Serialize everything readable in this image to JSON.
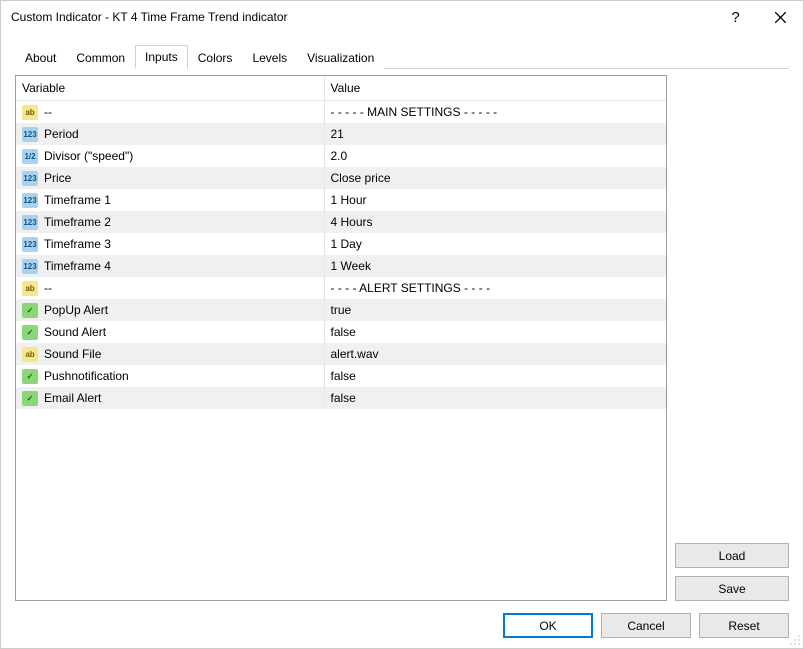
{
  "window": {
    "title": "Custom Indicator - KT 4 Time Frame Trend indicator"
  },
  "tabs": [
    "About",
    "Common",
    "Inputs",
    "Colors",
    "Levels",
    "Visualization"
  ],
  "active_tab": "Inputs",
  "table": {
    "headers": {
      "variable": "Variable",
      "value": "Value"
    },
    "rows": [
      {
        "icon": "string",
        "iconText": "ab",
        "variable": "--",
        "value": "- - - - - MAIN SETTINGS - - - - -"
      },
      {
        "icon": "int",
        "iconText": "123",
        "variable": "Period",
        "value": "21"
      },
      {
        "icon": "double",
        "iconText": "1/2",
        "variable": "Divisor (\"speed\")",
        "value": "2.0"
      },
      {
        "icon": "int",
        "iconText": "123",
        "variable": "Price",
        "value": "Close price"
      },
      {
        "icon": "int",
        "iconText": "123",
        "variable": "Timeframe 1",
        "value": "1 Hour"
      },
      {
        "icon": "int",
        "iconText": "123",
        "variable": "Timeframe 2",
        "value": "4 Hours"
      },
      {
        "icon": "int",
        "iconText": "123",
        "variable": "Timeframe 3",
        "value": "1 Day"
      },
      {
        "icon": "int",
        "iconText": "123",
        "variable": "Timeframe 4",
        "value": "1 Week"
      },
      {
        "icon": "string",
        "iconText": "ab",
        "variable": "--",
        "value": "- - - - ALERT SETTINGS - - - -"
      },
      {
        "icon": "bool",
        "iconText": "✓",
        "variable": "PopUp Alert",
        "value": "true"
      },
      {
        "icon": "bool",
        "iconText": "✓",
        "variable": "Sound Alert",
        "value": "false"
      },
      {
        "icon": "string",
        "iconText": "ab",
        "variable": "Sound File",
        "value": "alert.wav"
      },
      {
        "icon": "bool",
        "iconText": "✓",
        "variable": "Pushnotification",
        "value": "false"
      },
      {
        "icon": "bool",
        "iconText": "✓",
        "variable": "Email Alert",
        "value": "false"
      }
    ]
  },
  "buttons": {
    "load": "Load",
    "save": "Save",
    "ok": "OK",
    "cancel": "Cancel",
    "reset": "Reset"
  }
}
